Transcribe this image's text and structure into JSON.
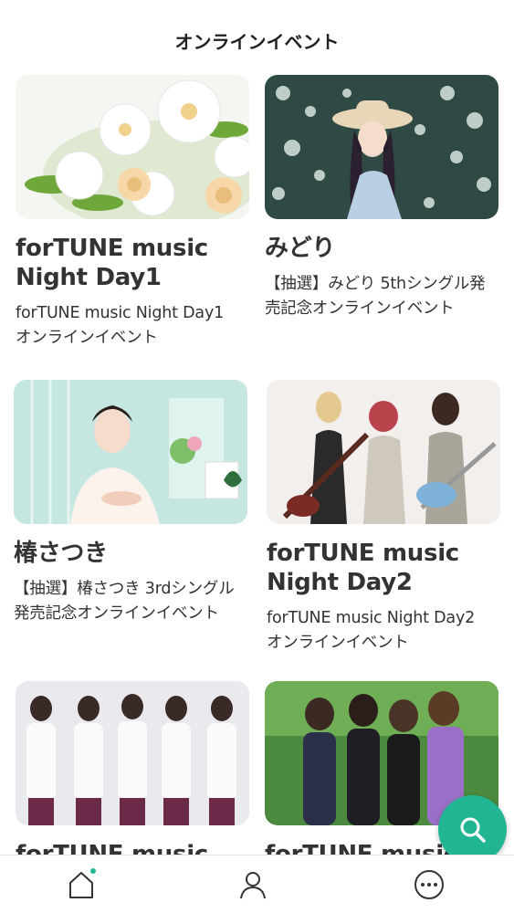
{
  "header": {
    "title": "オンラインイベント"
  },
  "events": [
    {
      "title": "forTUNE music\nNight Day1",
      "subtitle": "forTUNE music Night Day1\nオンラインイベント",
      "image": "white-flowers-bouquet"
    },
    {
      "title": "みどり",
      "subtitle": "【抽選】みどり 5thシングル発\n売記念オンラインイベント",
      "image": "woman-hat-flowers"
    },
    {
      "title": "椿さつき",
      "subtitle": "【抽選】椿さつき 3rdシングル\n発売記念オンラインイベント",
      "image": "woman-white-room"
    },
    {
      "title": "forTUNE music\nNight Day2",
      "subtitle": "forTUNE music Night Day2\nオンラインイベント",
      "image": "girl-band-guitars"
    },
    {
      "title": "forTUNE music",
      "subtitle": "",
      "image": "five-women-group"
    },
    {
      "title": "forTUNE music",
      "subtitle": "",
      "image": "four-women-outdoor"
    }
  ],
  "fab": {
    "icon": "search-icon"
  },
  "bottom_nav": [
    {
      "name": "home",
      "icon": "home-icon",
      "active": true
    },
    {
      "name": "profile",
      "icon": "person-icon",
      "active": false
    },
    {
      "name": "more",
      "icon": "more-icon",
      "active": false
    }
  ],
  "colors": {
    "accent": "#22b594",
    "text": "#333333"
  }
}
